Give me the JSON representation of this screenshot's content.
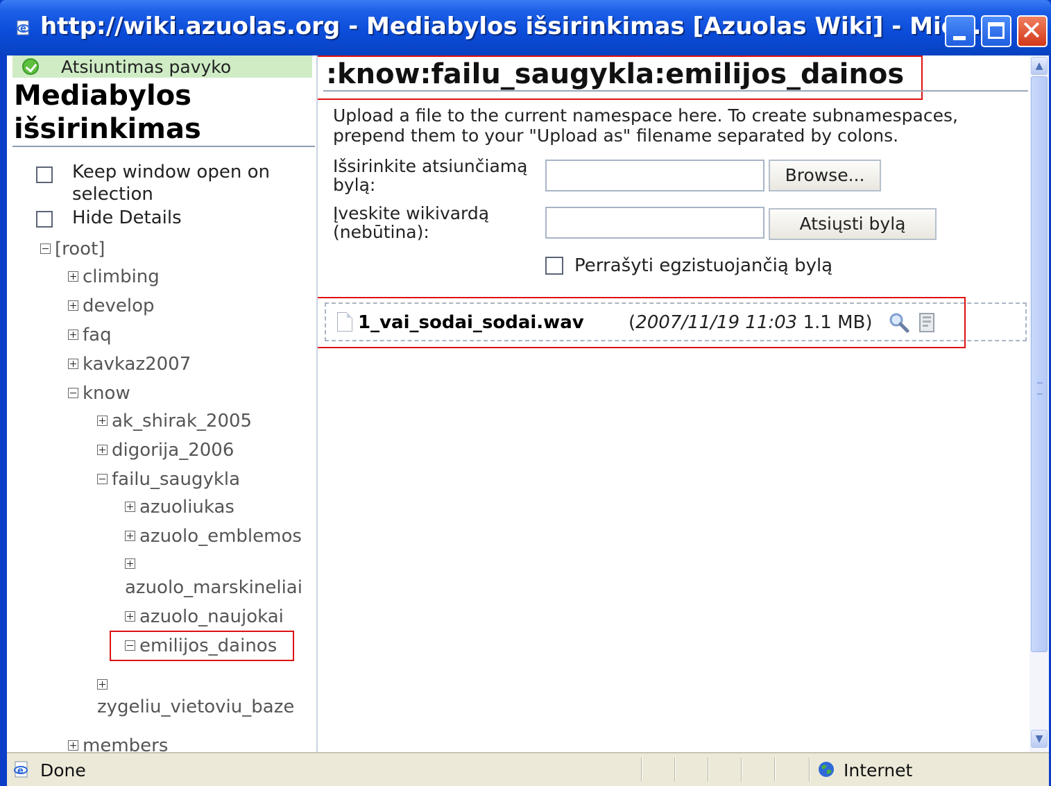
{
  "window": {
    "title": "http://wiki.azuolas.org - Mediabylos išsirinkimas [Azuolas Wiki] - Micr..."
  },
  "sidebar": {
    "success_message": "Atsiuntimas pavyko",
    "title_line1": "Mediabylos",
    "title_line2": "išsirinkimas",
    "options": {
      "keep_open_line1": "Keep window open on",
      "keep_open_line2": "selection",
      "hide_details": "Hide Details"
    },
    "tree": {
      "root": "[root]",
      "climbing": "climbing",
      "develop": "develop",
      "faq": "faq",
      "kavkaz2007": "kavkaz2007",
      "know": "know",
      "ak_shirak": "ak_shirak_2005",
      "digorija": "digorija_2006",
      "failu_saugykla": "failu_saugykla",
      "azuoliukas": "azuoliukas",
      "azuolo_emblemos": "azuolo_emblemos",
      "azuolo_marskineliai": "azuolo_marskineliai",
      "azuolo_naujokai": "azuolo_naujokai",
      "emilijos_dainos": "emilijos_dainos",
      "zygeliu": "zygeliu_vietoviu_baze",
      "members": "members"
    }
  },
  "main": {
    "namespace_title": ":know:failu_saugykla:emilijos_dainos",
    "intro_line1": "Upload a file to the current namespace here. To create subnamespaces,",
    "intro_line2": "prepend them to your \"Upload as\" filename separated by colons.",
    "select_file_label_line1": "Išsirinkite atsiunčiamą",
    "select_file_label_line2": "bylą:",
    "browse_button": "Browse...",
    "wikiname_label_line1": "Įveskite wikivardą",
    "wikiname_label_line2": "(nebūtina):",
    "upload_button": "Atsiųsti bylą",
    "overwrite_label": "Perrašyti egzistuojančią bylą",
    "file": {
      "name": "1_vai_sodai_sodai.wav",
      "date": "2007/11/19 11:03",
      "size": "1.1 MB"
    }
  },
  "statusbar": {
    "status": "Done",
    "zone": "Internet"
  },
  "colors": {
    "titlebar": "#0a4bd8",
    "success_bg": "#cfecc5",
    "highlight": "#dd1111"
  }
}
